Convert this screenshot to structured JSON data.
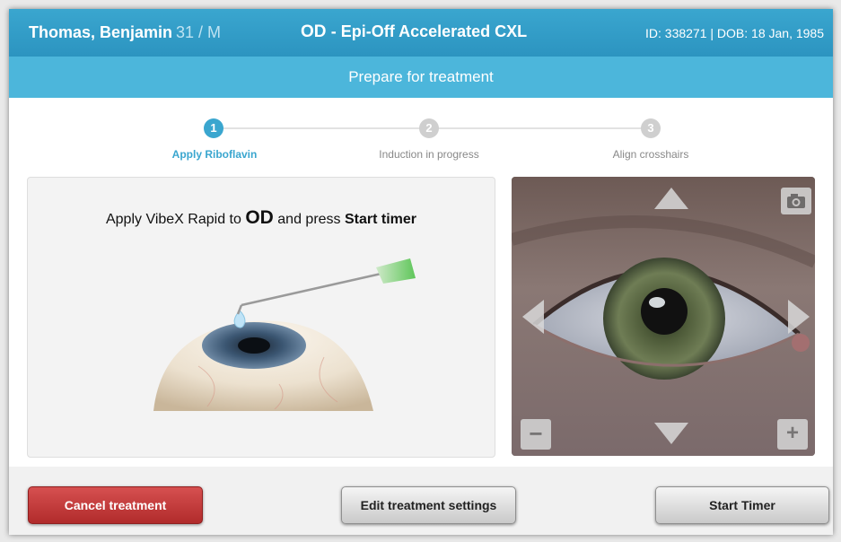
{
  "header": {
    "patient_name": "Thomas, Benjamin",
    "patient_age_sex": "31 / M",
    "eye": "OD",
    "procedure": "- Epi-Off Accelerated CXL",
    "patient_id": "ID: 338271 | DOB: 18 Jan, 1985"
  },
  "subheader": {
    "title": "Prepare for treatment"
  },
  "steps": [
    {
      "number": "1",
      "label": "Apply Riboflavin",
      "state": "active"
    },
    {
      "number": "2",
      "label": "Induction in progress",
      "state": "inactive"
    },
    {
      "number": "3",
      "label": "Align crosshairs",
      "state": "inactive"
    }
  ],
  "instruction": {
    "prefix": "Apply VibeX Rapid to ",
    "eye": "OD",
    "middle": " and press ",
    "action": "Start timer"
  },
  "camera": {
    "controls": [
      "camera-icon",
      "arrow-up-icon",
      "arrow-down-icon",
      "arrow-left-icon",
      "arrow-right-icon",
      "zoom-out-icon",
      "zoom-in-icon"
    ],
    "zoom_out_label": "−",
    "zoom_in_label": "+"
  },
  "footer": {
    "cancel_label": "Cancel treatment",
    "edit_label": "Edit treatment settings",
    "start_label": "Start Timer"
  },
  "colors": {
    "header": "#2c94c0",
    "subheader": "#4cb6db",
    "step_active": "#3aa6cf",
    "step_inactive": "#cfcfcf",
    "cancel": "#c03a3a"
  }
}
